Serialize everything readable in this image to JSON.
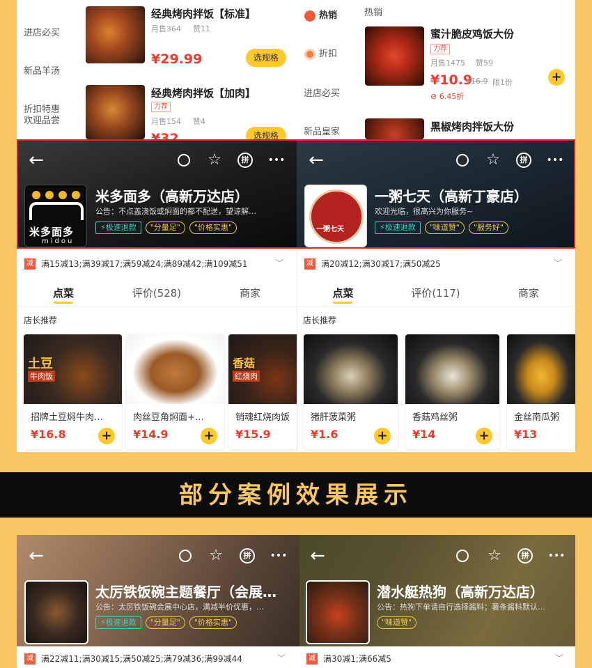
{
  "top_left_menu": {
    "categories": [
      "进店必买",
      "新品羊汤",
      "折扣特惠",
      "欢迎品尝"
    ],
    "items": [
      {
        "name": "经典烤肉拌饭【标准】",
        "sales": "月售364",
        "likes": "赞11",
        "price": "¥29.99",
        "button": "选规格"
      },
      {
        "name": "经典烤肉拌饭【加肉】",
        "tag": "力荐",
        "sales": "月售154",
        "likes": "赞4",
        "price": "¥32",
        "button": "选规格"
      }
    ]
  },
  "top_right_menu": {
    "categories": [
      {
        "label": "热销",
        "icon": "fire-icon"
      },
      {
        "label": "折扣",
        "icon": "discount-icon"
      },
      {
        "label": "进店必买"
      },
      {
        "label": "新品皇家"
      }
    ],
    "section_title": "热销",
    "items": [
      {
        "name": "蜜汁脆皮鸡饭大份",
        "tag": "力荐",
        "sales": "月售1475",
        "likes": "赞59",
        "price": "¥10.9",
        "old_price": "¥16.9",
        "limit": "限1份",
        "coupon": "6.45折"
      },
      {
        "name": "黑椒烤肉拌饭大份"
      }
    ]
  },
  "stores_top": [
    {
      "name": "米多面多（高新万达店）",
      "notice": "公告：不点盖浇饭或焖面的都不配送，望谅解…",
      "chips": [
        "极速退款",
        "\"分量足\"",
        "\"价格实惠\""
      ],
      "logo_text": "米多面多",
      "logo_sub": "midou",
      "discount": "满15减13;满39减17;满59减24;满89减42;满109减51",
      "tabs": [
        "点菜",
        "评价(528)",
        "商家"
      ],
      "recommend_title": "店长推荐",
      "dishes": [
        {
          "name": "招牌土豆焖牛肉…",
          "price": "¥16.8",
          "overlay": "土豆",
          "overlay2": "牛肉饭"
        },
        {
          "name": "肉丝豆角焖面+…",
          "price": "¥14.9"
        },
        {
          "name": "销魂红烧肉饭",
          "price": "¥15.9",
          "overlay": "香菇",
          "overlay2": "红烧肉"
        }
      ]
    },
    {
      "name": "一粥七天（高新丁豪店）",
      "notice": "欢迎光临，很高兴为你服务~",
      "chips": [
        "极速退款",
        "\"味道赞\"",
        "\"服务好\""
      ],
      "logo_text": "一粥七天",
      "discount": "满20减12;满30减17;满50减25",
      "tabs": [
        "点菜",
        "评价(117)",
        "商家"
      ],
      "recommend_title": "店长推荐",
      "dishes": [
        {
          "name": "猪肝菠菜粥",
          "price": "¥1.6"
        },
        {
          "name": "香菇鸡丝粥",
          "price": "¥14"
        },
        {
          "name": "金丝南瓜粥",
          "price": "¥13"
        }
      ]
    }
  ],
  "banner": {
    "title": "部分案例效果展示"
  },
  "stores_bottom": [
    {
      "name": "太厉铁饭碗主题餐厅（会展…",
      "notice": "公告：太厉铁饭碗会展中心店，满减半价优惠，…",
      "chips": [
        "极速退款",
        "\"分量足\"",
        "\"价格实惠\""
      ],
      "discount": "满22减11;满30减15;满50减25;满79减36;满99减44"
    },
    {
      "name": "潜水艇热狗（高新万达店）",
      "notice": "公告：热狗下单请自行选择酱料；薯条酱料默认…",
      "chips": [
        "\"味道赞\""
      ],
      "discount": "满30减1;满66减5"
    }
  ],
  "header_icons": {
    "back": "←",
    "search": "○",
    "star": "☆",
    "pin": "拼",
    "more": "•••"
  },
  "discount_badge": "减",
  "colors": {
    "accent": "#ffc82c",
    "price": "#ee3a2d",
    "page_bg": "#f8c662",
    "highlight_border": "#e02424",
    "banner_bg": "#0d0d0d",
    "banner_text": "#f8c662"
  }
}
